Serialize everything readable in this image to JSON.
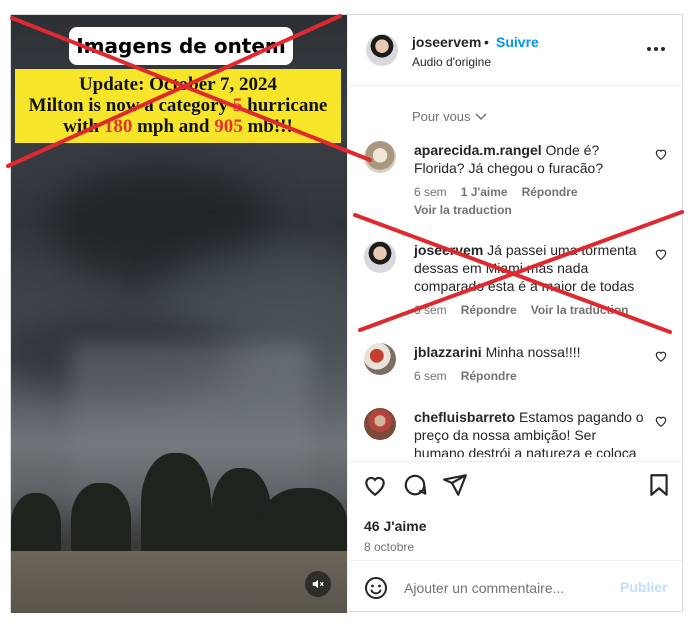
{
  "media": {
    "title": "Imagens de ontem",
    "update_line": "Update: October 7, 2024",
    "line2_a": "Milton is now a category ",
    "line2_num": "5",
    "line2_b": " hurricane",
    "line3_a": "with ",
    "line3_speed": "180",
    "line3_b": " mph and ",
    "line3_pressure": "905",
    "line3_c": " mb!!!",
    "mute_icon": "speaker-muted-icon"
  },
  "header": {
    "username": "joseervem",
    "dot": "•",
    "follow_label": "Suivre",
    "audio": "Audio d'origine",
    "more_icon": "more-horizontal-icon"
  },
  "comments_section": {
    "filter_label": "Pour vous",
    "items": [
      {
        "user": "aparecida.m.rangel",
        "text": "Onde é? Florida? Já chegou o furacão?",
        "time": "6 sem",
        "likes": "1 J'aime",
        "reply": "Répondre",
        "translate": "Voir la traduction"
      },
      {
        "user": "joseervem",
        "text": "Já passei uma tormenta dessas em Miami mas nada comparado esta é a maior de todas",
        "time": "6 sem",
        "reply": "Répondre",
        "translate": "Voir la traduction"
      },
      {
        "user": "jblazzarini",
        "text": "Minha nossa!!!!",
        "time": "6 sem",
        "reply": "Répondre"
      },
      {
        "user": "chefluisbarreto",
        "text": "Estamos pagando o preço da nossa ambição! Ser humano destrói a natureza e coloca"
      }
    ]
  },
  "actions": {
    "likes": "46 J'aime",
    "date": "8 octobre",
    "icons": [
      "heart-icon",
      "comment-icon",
      "share-icon",
      "bookmark-icon"
    ]
  },
  "composer": {
    "placeholder": "Ajouter un commentaire...",
    "publish_label": "Publier"
  },
  "colors": {
    "accent": "#0095f6",
    "overlay_yellow": "#f7e52a",
    "cross_red": "#e0282f"
  }
}
